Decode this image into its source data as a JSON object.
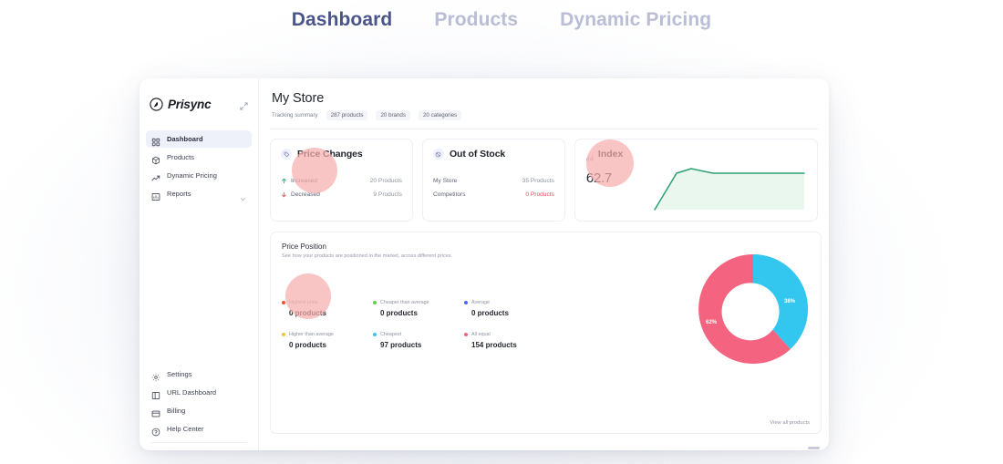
{
  "topnav": {
    "items": [
      {
        "label": "Dashboard",
        "active": true
      },
      {
        "label": "Products",
        "active": false
      },
      {
        "label": "Dynamic Pricing",
        "active": false
      }
    ]
  },
  "sidebar": {
    "brand": "Prisync",
    "brand_icon": "prisync-logo-icon",
    "collapse_icon": "collapse-icon",
    "items": [
      {
        "label": "Dashboard",
        "icon": "grid-icon",
        "active": true
      },
      {
        "label": "Products",
        "icon": "box-icon",
        "active": false
      },
      {
        "label": "Dynamic Pricing",
        "icon": "trend-up-icon",
        "active": false
      },
      {
        "label": "Reports",
        "icon": "bar-chart-icon",
        "active": false,
        "chevron": "chevron-down-icon"
      }
    ],
    "bottom_items": [
      {
        "label": "Settings",
        "icon": "gear-icon"
      },
      {
        "label": "URL Dashboard",
        "icon": "layout-icon"
      },
      {
        "label": "Billing",
        "icon": "credit-card-icon"
      },
      {
        "label": "Help Center",
        "icon": "question-circle-icon"
      }
    ]
  },
  "header": {
    "title": "My Store",
    "summary_label": "Tracking summary",
    "chips": [
      "287 products",
      "20 brands",
      "20 categories"
    ]
  },
  "cards": {
    "price_changes": {
      "title": "Price Changes",
      "icon": "tag-icon",
      "rows": [
        {
          "label": "Increased",
          "value": "20 Products",
          "icon": "arrow-up-icon",
          "direction": "up"
        },
        {
          "label": "Decreased",
          "value": "9 Products",
          "icon": "arrow-down-icon",
          "direction": "down"
        }
      ]
    },
    "out_of_stock": {
      "title": "Out of Stock",
      "icon": "stock-icon",
      "rows": [
        {
          "label": "My Store",
          "value": "35 Products",
          "tone": "muted"
        },
        {
          "label": "Competitors",
          "value": "0 Products",
          "tone": "danger"
        }
      ]
    },
    "index": {
      "title": "Index",
      "icon": "chart-icon",
      "value": "62.7",
      "line_color": "#2e9e72",
      "fill_color": "#e9f7ef"
    }
  },
  "price_position": {
    "title": "Price Position",
    "subtitle": "See how your products are positioned in the market, across different prices.",
    "view_all_label": "View all products",
    "legend": [
      {
        "name": "Highest price",
        "value": "0 products",
        "color": "#f2562f"
      },
      {
        "name": "Cheaper than average",
        "value": "0 products",
        "color": "#5fd14f"
      },
      {
        "name": "Average",
        "value": "0 products",
        "color": "#4a6ae8"
      },
      {
        "name": "Higher than average",
        "value": "0 products",
        "color": "#f5c23a"
      },
      {
        "name": "Cheapest",
        "value": "97 products",
        "color": "#33c6ef"
      },
      {
        "name": "All equal",
        "value": "154 products",
        "color": "#f4637f"
      }
    ]
  },
  "chart_data": {
    "type": "pie",
    "title": "Price Position",
    "subtitle": "See how your products are positioned in the market, across different prices.",
    "categories": [
      "All equal",
      "Cheapest"
    ],
    "values": [
      154,
      97
    ],
    "percentages": [
      62,
      38
    ],
    "percent_labels": [
      "62%",
      "38%"
    ],
    "colors": [
      "#f4637f",
      "#33c6ef"
    ],
    "legend_position": "left",
    "donut": true,
    "all_categories": [
      {
        "name": "Highest price",
        "value": 0,
        "color": "#f2562f"
      },
      {
        "name": "Cheaper than average",
        "value": 0,
        "color": "#5fd14f"
      },
      {
        "name": "Average",
        "value": 0,
        "color": "#4a6ae8"
      },
      {
        "name": "Higher than average",
        "value": 0,
        "color": "#f5c23a"
      },
      {
        "name": "Cheapest",
        "value": 97,
        "color": "#33c6ef"
      },
      {
        "name": "All equal",
        "value": 154,
        "color": "#f4637f"
      }
    ]
  },
  "index_sparkline": {
    "type": "area",
    "title": "Index",
    "value": 62.7,
    "x": [
      0,
      1,
      2,
      3,
      4,
      5,
      6,
      7
    ],
    "y": [
      4,
      48,
      56,
      52,
      51,
      51,
      51,
      51
    ],
    "line_color": "#2e9e72",
    "fill_color": "#e9f7ef",
    "grid": false
  }
}
